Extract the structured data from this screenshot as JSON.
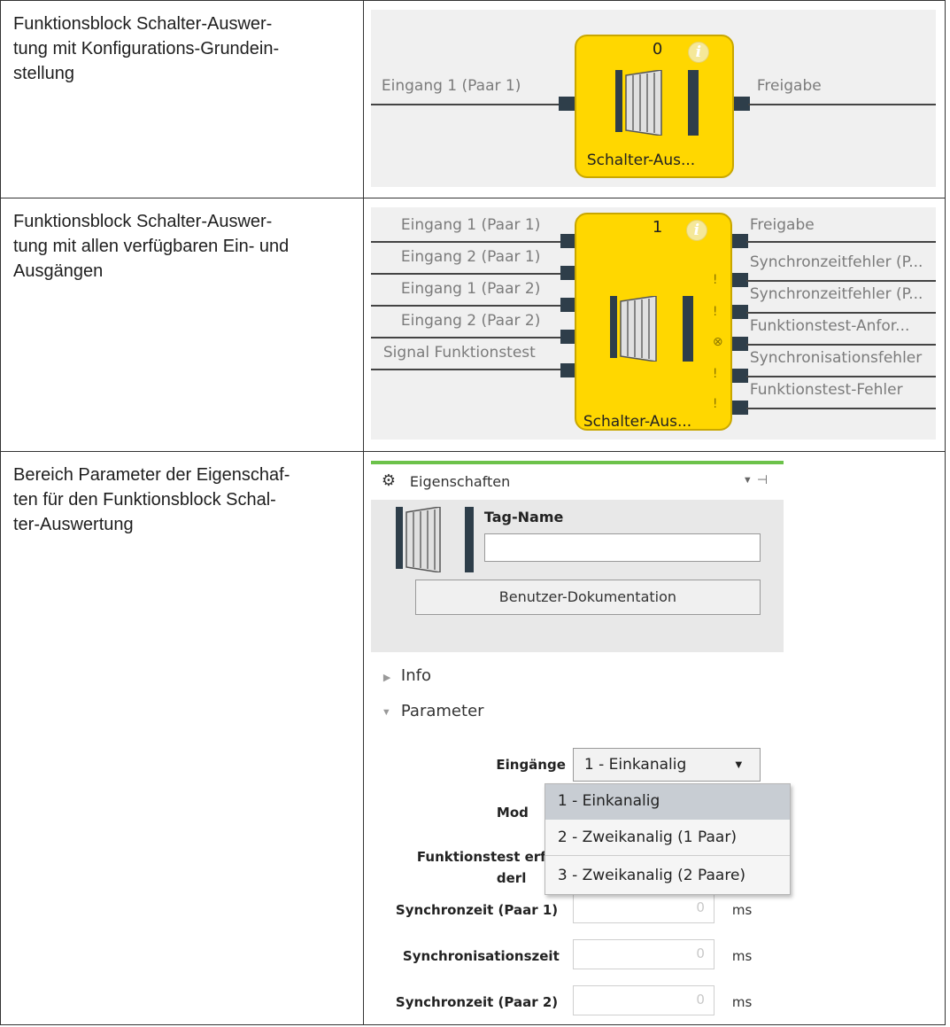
{
  "rows": [
    {
      "description_lines": [
        "Funktionsblock Schalter-Auswer-",
        "tung mit Konfigurations-Grundein-",
        "stellung"
      ],
      "block": {
        "number": "0",
        "name": "Schalter-Aus...",
        "inputs": [
          "Eingang 1 (Paar 1)"
        ],
        "outputs": [
          "Freigabe"
        ]
      }
    },
    {
      "description_lines": [
        "Funktionsblock Schalter-Auswer-",
        "tung mit allen verfügbaren Ein- und",
        "Ausgängen"
      ],
      "block": {
        "number": "1",
        "name": "Schalter-Aus...",
        "inputs": [
          "Eingang 1 (Paar 1)",
          "Eingang 2 (Paar 1)",
          "Eingang 1 (Paar 2)",
          "Eingang 2 (Paar 2)",
          "Signal Funktionstest"
        ],
        "outputs": [
          "Freigabe",
          "Synchronzeitfehler (P...",
          "Synchronzeitfehler (P...",
          "Funktionstest-Anfor...",
          "Synchronisationsfehler",
          "Funktionstest-Fehler"
        ],
        "output_icons": [
          "!",
          "!",
          "⊗",
          "!",
          "!"
        ]
      }
    },
    {
      "description_lines": [
        "Bereich Parameter der Eigenschaf-",
        "ten für den Funktionsblock Schal-",
        "ter-Auswertung"
      ]
    }
  ],
  "properties": {
    "title": "Eigenschaften",
    "tag_name_label": "Tag-Name",
    "tag_name_value": "",
    "user_doc_button": "Benutzer-Dokumentation",
    "info_section": "Info",
    "parameter_section": "Parameter",
    "inputs_label": "Eingänge",
    "inputs_value": "1 - Einkanalig",
    "dropdown_options": [
      "1 - Einkanalig",
      "2 - Zweikanalig (1 Paar)",
      "3 - Zweikanalig (2 Paare)"
    ],
    "mode_label_visible": "Mod",
    "functest_label_line1": "Funktionstest erf",
    "functest_label_line2": "derl",
    "sync_pair1_label": "Synchronzeit (Paar 1)",
    "sync_pair1_value": "0",
    "sync_time_label": "Synchronisationszeit",
    "sync_time_value": "0",
    "sync_pair2_label": "Synchronzeit (Paar 2)",
    "sync_pair2_value": "0",
    "unit": "ms"
  },
  "colors": {
    "block_fill": "#ffd700",
    "accent_green": "#6cc24a",
    "pin": "#2e3e4a"
  }
}
